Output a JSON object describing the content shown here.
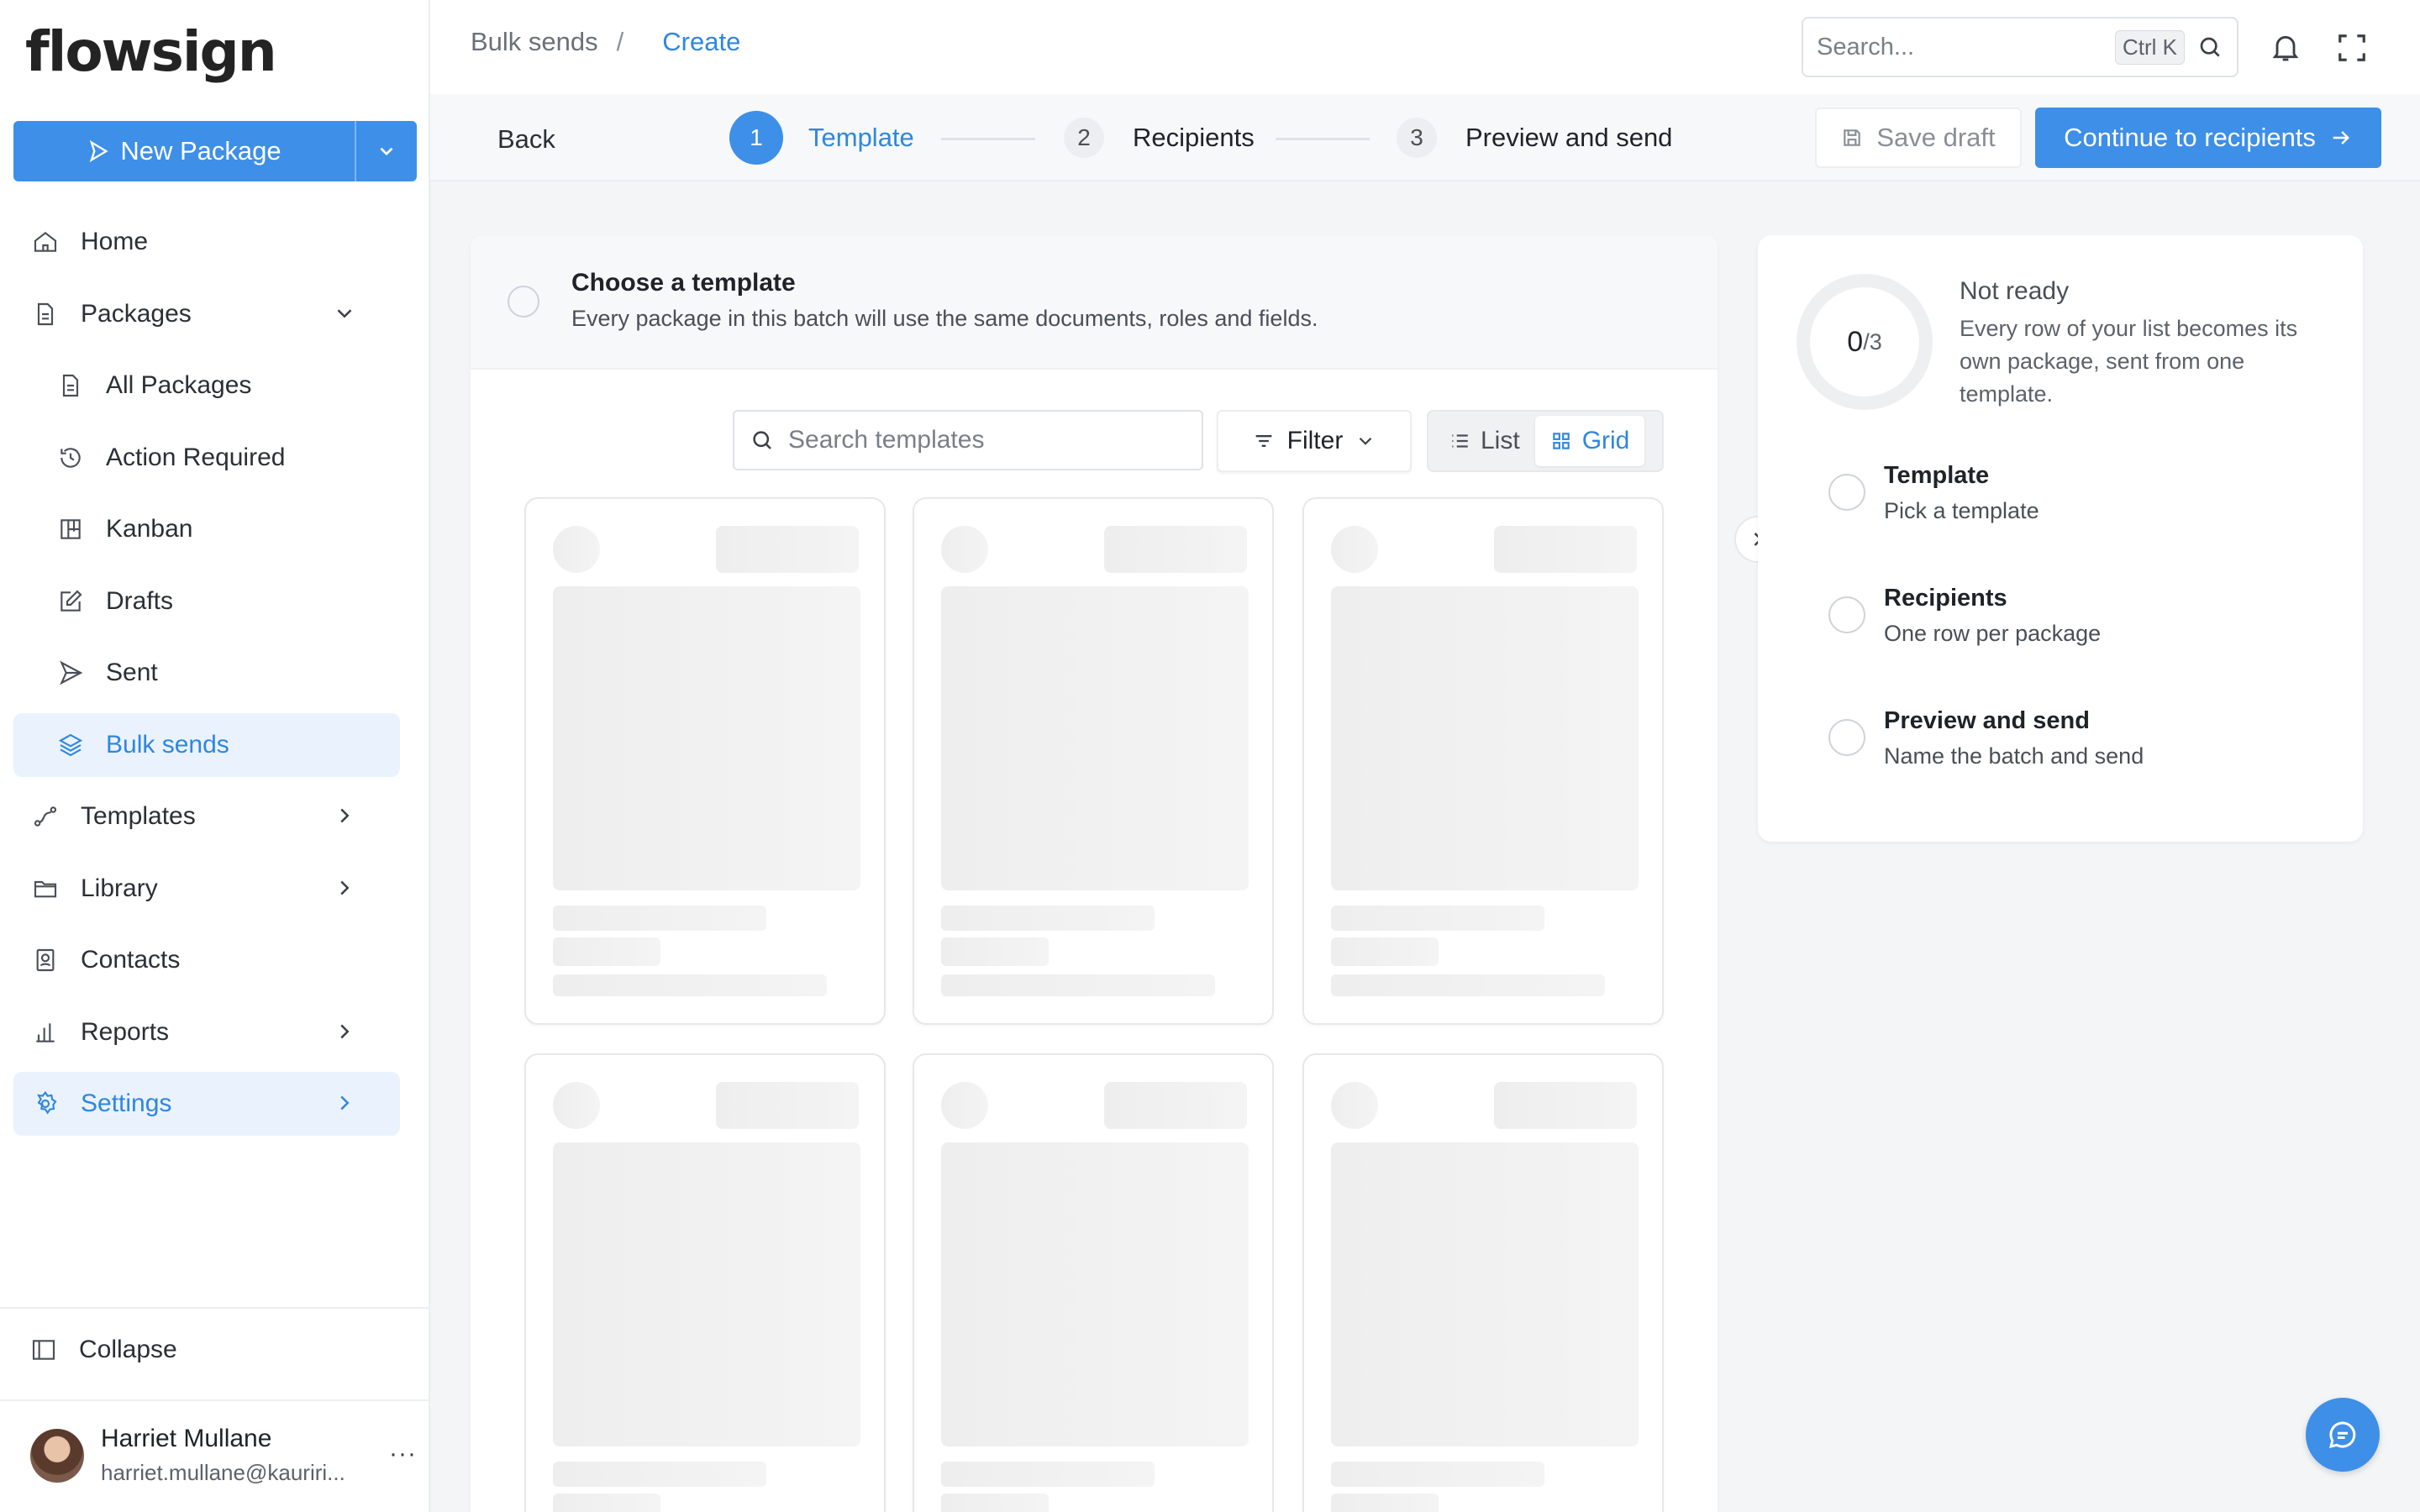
{
  "brand": {
    "logo_text": "flowsign"
  },
  "sidebar": {
    "new_package_label": "New Package",
    "items": [
      {
        "label": "Home",
        "icon": "home-icon"
      },
      {
        "label": "Packages",
        "icon": "file-icon"
      },
      {
        "label": "All Packages",
        "icon": "file-icon"
      },
      {
        "label": "Action Required",
        "icon": "history-icon"
      },
      {
        "label": "Kanban",
        "icon": "kanban-icon"
      },
      {
        "label": "Drafts",
        "icon": "edit-icon"
      },
      {
        "label": "Sent",
        "icon": "send-icon"
      },
      {
        "label": "Bulk sends",
        "icon": "layers-icon"
      },
      {
        "label": "Templates",
        "icon": "route-icon"
      },
      {
        "label": "Library",
        "icon": "folder-icon"
      },
      {
        "label": "Contacts",
        "icon": "contact-icon"
      },
      {
        "label": "Reports",
        "icon": "bar-chart-icon"
      },
      {
        "label": "Settings",
        "icon": "gear-icon"
      }
    ],
    "collapse_label": "Collapse",
    "user": {
      "name": "Harriet Mullane",
      "email": "harriet.mullane@kauriri...",
      "more": "···"
    }
  },
  "header": {
    "breadcrumb": [
      "Bulk sends",
      "/",
      "Create"
    ],
    "search_placeholder": "Search...",
    "search_shortcut": "Ctrl K"
  },
  "stepbar": {
    "back_label": "Back",
    "steps": [
      {
        "num": "1",
        "label": "Template"
      },
      {
        "num": "2",
        "label": "Recipients"
      },
      {
        "num": "3",
        "label": "Preview and send"
      }
    ],
    "save_draft_label": "Save draft",
    "continue_label": "Continue to recipients"
  },
  "main": {
    "title": "Choose a template",
    "subtitle": "Every package in this batch will use the same documents, roles and fields.",
    "search_placeholder": "Search templates",
    "filter_label": "Filter",
    "view_list_label": "List",
    "view_grid_label": "Grid"
  },
  "panel": {
    "progress_done": "0",
    "progress_total": "/3",
    "status": "Not ready",
    "description": "Every row of your list becomes its own package, sent from one template.",
    "steps": [
      {
        "title": "Template",
        "subtitle": "Pick a template"
      },
      {
        "title": "Recipients",
        "subtitle": "One row per package"
      },
      {
        "title": "Preview and send",
        "subtitle": "Name the batch and send"
      }
    ]
  },
  "colors": {
    "accent": "#3d8fe8",
    "active_bg": "#eaf3fd",
    "skeleton": "#eeeeee"
  }
}
